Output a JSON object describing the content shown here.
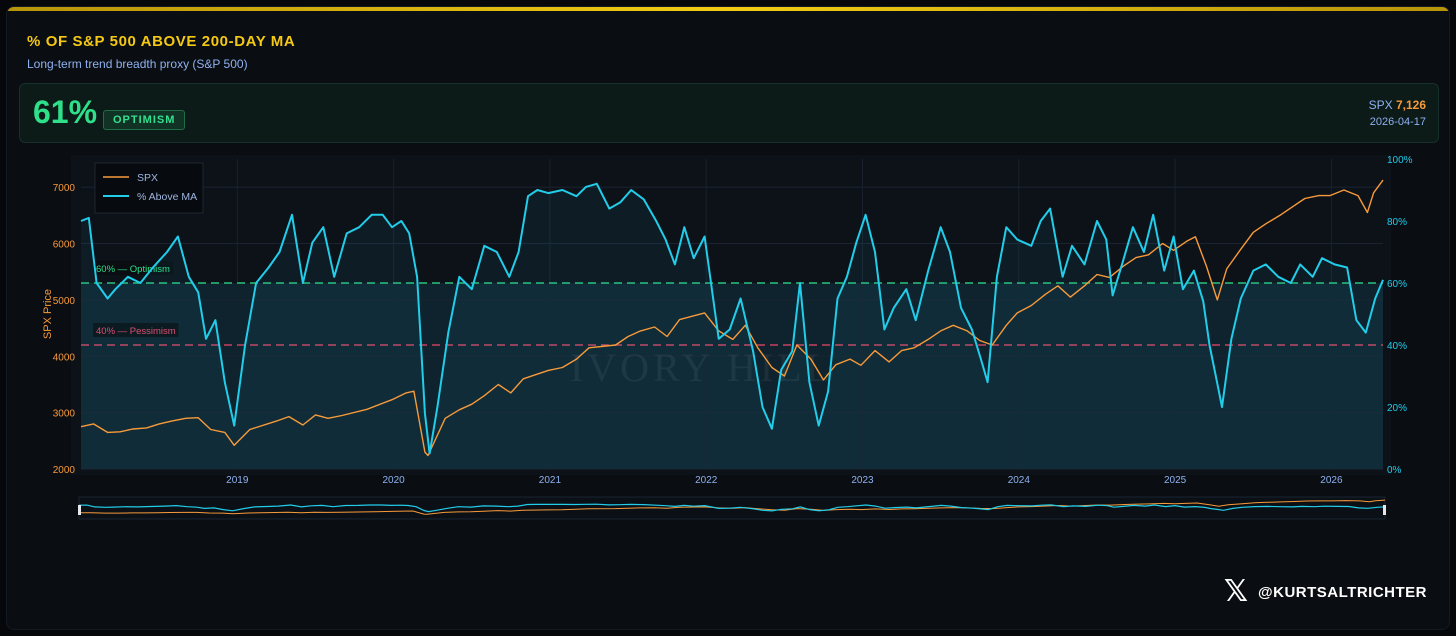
{
  "header": {
    "title": "% OF S&P 500 ABOVE 200-DAY MA",
    "subtitle": "Long-term trend breadth proxy (S&P 500)"
  },
  "stat": {
    "value": "61%",
    "badge": "OPTIMISM",
    "spx_label": "SPX",
    "spx_value": "7,126",
    "date": "2026-04-17"
  },
  "watermark": "IVORY HILL",
  "branding": {
    "handle": "@KURTSALTRICHTER",
    "logo_icon": "x-logo-icon"
  },
  "colors": {
    "spx": "#f89a3a",
    "breadth": "#22cdea",
    "optimism": "#2ee08a",
    "pessimism": "#e8496b",
    "title": "#f4c915"
  },
  "chart_data": {
    "type": "line",
    "ylabel_left": "SPX Price",
    "ylim_left": [
      2000,
      7500
    ],
    "yticks_left": [
      "2000",
      "3000",
      "4000",
      "5000",
      "6000",
      "7000"
    ],
    "ylim_right": [
      0,
      100
    ],
    "yticks_right": [
      "0%",
      "20%",
      "40%",
      "60%",
      "80%",
      "100%"
    ],
    "xlim": [
      2018.0,
      2026.33
    ],
    "xticks": [
      "2019",
      "2020",
      "2021",
      "2022",
      "2023",
      "2024",
      "2025",
      "2026"
    ],
    "legend": {
      "placement": "top-left"
    },
    "thresholds": [
      {
        "label": "60% — Optimism",
        "value": 60
      },
      {
        "label": "40% — Pessimism",
        "value": 40
      }
    ],
    "series": [
      {
        "name": "SPX",
        "axis": "left",
        "points": [
          [
            2018.0,
            2750
          ],
          [
            2018.08,
            2800
          ],
          [
            2018.17,
            2650
          ],
          [
            2018.25,
            2660
          ],
          [
            2018.33,
            2710
          ],
          [
            2018.42,
            2730
          ],
          [
            2018.5,
            2800
          ],
          [
            2018.58,
            2850
          ],
          [
            2018.67,
            2900
          ],
          [
            2018.75,
            2910
          ],
          [
            2018.83,
            2700
          ],
          [
            2018.92,
            2650
          ],
          [
            2018.98,
            2420
          ],
          [
            2019.08,
            2700
          ],
          [
            2019.25,
            2850
          ],
          [
            2019.33,
            2930
          ],
          [
            2019.42,
            2780
          ],
          [
            2019.5,
            2960
          ],
          [
            2019.58,
            2900
          ],
          [
            2019.67,
            2950
          ],
          [
            2019.83,
            3060
          ],
          [
            2019.99,
            3230
          ],
          [
            2020.08,
            3350
          ],
          [
            2020.13,
            3380
          ],
          [
            2020.2,
            2300
          ],
          [
            2020.22,
            2240
          ],
          [
            2020.33,
            2900
          ],
          [
            2020.42,
            3050
          ],
          [
            2020.5,
            3150
          ],
          [
            2020.58,
            3300
          ],
          [
            2020.67,
            3500
          ],
          [
            2020.75,
            3350
          ],
          [
            2020.83,
            3600
          ],
          [
            2020.99,
            3750
          ],
          [
            2021.08,
            3800
          ],
          [
            2021.17,
            3950
          ],
          [
            2021.25,
            4150
          ],
          [
            2021.42,
            4200
          ],
          [
            2021.5,
            4350
          ],
          [
            2021.58,
            4450
          ],
          [
            2021.67,
            4520
          ],
          [
            2021.75,
            4350
          ],
          [
            2021.83,
            4650
          ],
          [
            2021.99,
            4770
          ],
          [
            2022.08,
            4450
          ],
          [
            2022.17,
            4300
          ],
          [
            2022.25,
            4550
          ],
          [
            2022.33,
            4150
          ],
          [
            2022.42,
            3800
          ],
          [
            2022.5,
            3650
          ],
          [
            2022.58,
            4200
          ],
          [
            2022.67,
            3950
          ],
          [
            2022.75,
            3580
          ],
          [
            2022.83,
            3850
          ],
          [
            2022.92,
            3950
          ],
          [
            2022.99,
            3840
          ],
          [
            2023.08,
            4100
          ],
          [
            2023.17,
            3900
          ],
          [
            2023.25,
            4100
          ],
          [
            2023.33,
            4150
          ],
          [
            2023.42,
            4300
          ],
          [
            2023.5,
            4450
          ],
          [
            2023.58,
            4550
          ],
          [
            2023.67,
            4450
          ],
          [
            2023.75,
            4280
          ],
          [
            2023.83,
            4200
          ],
          [
            2023.92,
            4550
          ],
          [
            2023.99,
            4770
          ],
          [
            2024.08,
            4900
          ],
          [
            2024.17,
            5100
          ],
          [
            2024.25,
            5250
          ],
          [
            2024.33,
            5050
          ],
          [
            2024.42,
            5250
          ],
          [
            2024.5,
            5450
          ],
          [
            2024.58,
            5400
          ],
          [
            2024.67,
            5600
          ],
          [
            2024.75,
            5750
          ],
          [
            2024.83,
            5800
          ],
          [
            2024.92,
            6000
          ],
          [
            2024.99,
            5880
          ],
          [
            2025.08,
            6050
          ],
          [
            2025.13,
            6120
          ],
          [
            2025.2,
            5600
          ],
          [
            2025.27,
            5000
          ],
          [
            2025.33,
            5550
          ],
          [
            2025.42,
            5900
          ],
          [
            2025.5,
            6200
          ],
          [
            2025.58,
            6350
          ],
          [
            2025.67,
            6500
          ],
          [
            2025.75,
            6650
          ],
          [
            2025.83,
            6800
          ],
          [
            2025.92,
            6850
          ],
          [
            2025.99,
            6850
          ],
          [
            2026.08,
            6950
          ],
          [
            2026.17,
            6850
          ],
          [
            2026.23,
            6550
          ],
          [
            2026.27,
            6900
          ],
          [
            2026.33,
            7126
          ]
        ]
      },
      {
        "name": "% Above MA",
        "axis": "right",
        "points": [
          [
            2018.0,
            80
          ],
          [
            2018.05,
            81
          ],
          [
            2018.1,
            60
          ],
          [
            2018.17,
            55
          ],
          [
            2018.22,
            58
          ],
          [
            2018.3,
            62
          ],
          [
            2018.38,
            60
          ],
          [
            2018.46,
            65
          ],
          [
            2018.55,
            70
          ],
          [
            2018.62,
            75
          ],
          [
            2018.69,
            62
          ],
          [
            2018.75,
            57
          ],
          [
            2018.8,
            42
          ],
          [
            2018.86,
            48
          ],
          [
            2018.92,
            28
          ],
          [
            2018.98,
            14
          ],
          [
            2019.05,
            40
          ],
          [
            2019.12,
            60
          ],
          [
            2019.2,
            65
          ],
          [
            2019.27,
            70
          ],
          [
            2019.35,
            82
          ],
          [
            2019.42,
            60
          ],
          [
            2019.48,
            73
          ],
          [
            2019.55,
            78
          ],
          [
            2019.62,
            62
          ],
          [
            2019.7,
            76
          ],
          [
            2019.78,
            78
          ],
          [
            2019.86,
            82
          ],
          [
            2019.93,
            82
          ],
          [
            2019.99,
            78
          ],
          [
            2020.05,
            80
          ],
          [
            2020.1,
            76
          ],
          [
            2020.15,
            62
          ],
          [
            2020.2,
            18
          ],
          [
            2020.23,
            5
          ],
          [
            2020.28,
            20
          ],
          [
            2020.35,
            44
          ],
          [
            2020.42,
            62
          ],
          [
            2020.5,
            58
          ],
          [
            2020.58,
            72
          ],
          [
            2020.66,
            70
          ],
          [
            2020.74,
            62
          ],
          [
            2020.8,
            70
          ],
          [
            2020.86,
            88
          ],
          [
            2020.92,
            90
          ],
          [
            2020.99,
            89
          ],
          [
            2021.08,
            90
          ],
          [
            2021.17,
            88
          ],
          [
            2021.23,
            91
          ],
          [
            2021.3,
            92
          ],
          [
            2021.38,
            84
          ],
          [
            2021.45,
            86
          ],
          [
            2021.52,
            90
          ],
          [
            2021.6,
            87
          ],
          [
            2021.68,
            80
          ],
          [
            2021.74,
            74
          ],
          [
            2021.8,
            66
          ],
          [
            2021.86,
            78
          ],
          [
            2021.92,
            68
          ],
          [
            2021.99,
            75
          ],
          [
            2022.08,
            42
          ],
          [
            2022.15,
            45
          ],
          [
            2022.22,
            55
          ],
          [
            2022.3,
            38
          ],
          [
            2022.36,
            20
          ],
          [
            2022.42,
            13
          ],
          [
            2022.48,
            32
          ],
          [
            2022.55,
            38
          ],
          [
            2022.6,
            60
          ],
          [
            2022.66,
            28
          ],
          [
            2022.72,
            14
          ],
          [
            2022.78,
            25
          ],
          [
            2022.84,
            55
          ],
          [
            2022.9,
            62
          ],
          [
            2022.96,
            73
          ],
          [
            2023.02,
            82
          ],
          [
            2023.08,
            70
          ],
          [
            2023.14,
            45
          ],
          [
            2023.2,
            52
          ],
          [
            2023.28,
            58
          ],
          [
            2023.34,
            48
          ],
          [
            2023.42,
            64
          ],
          [
            2023.5,
            78
          ],
          [
            2023.56,
            70
          ],
          [
            2023.63,
            52
          ],
          [
            2023.7,
            45
          ],
          [
            2023.76,
            35
          ],
          [
            2023.8,
            28
          ],
          [
            2023.86,
            62
          ],
          [
            2023.92,
            78
          ],
          [
            2023.99,
            74
          ],
          [
            2024.08,
            72
          ],
          [
            2024.14,
            80
          ],
          [
            2024.2,
            84
          ],
          [
            2024.28,
            62
          ],
          [
            2024.34,
            72
          ],
          [
            2024.42,
            66
          ],
          [
            2024.5,
            80
          ],
          [
            2024.56,
            74
          ],
          [
            2024.6,
            56
          ],
          [
            2024.66,
            66
          ],
          [
            2024.73,
            78
          ],
          [
            2024.8,
            70
          ],
          [
            2024.86,
            82
          ],
          [
            2024.93,
            64
          ],
          [
            2024.99,
            75
          ],
          [
            2025.05,
            58
          ],
          [
            2025.12,
            64
          ],
          [
            2025.18,
            54
          ],
          [
            2025.22,
            40
          ],
          [
            2025.26,
            30
          ],
          [
            2025.3,
            20
          ],
          [
            2025.36,
            42
          ],
          [
            2025.42,
            55
          ],
          [
            2025.5,
            64
          ],
          [
            2025.58,
            66
          ],
          [
            2025.66,
            62
          ],
          [
            2025.74,
            60
          ],
          [
            2025.8,
            66
          ],
          [
            2025.88,
            62
          ],
          [
            2025.94,
            68
          ],
          [
            2026.02,
            66
          ],
          [
            2026.1,
            65
          ],
          [
            2026.16,
            48
          ],
          [
            2026.22,
            44
          ],
          [
            2026.28,
            55
          ],
          [
            2026.33,
            61
          ]
        ]
      }
    ]
  }
}
